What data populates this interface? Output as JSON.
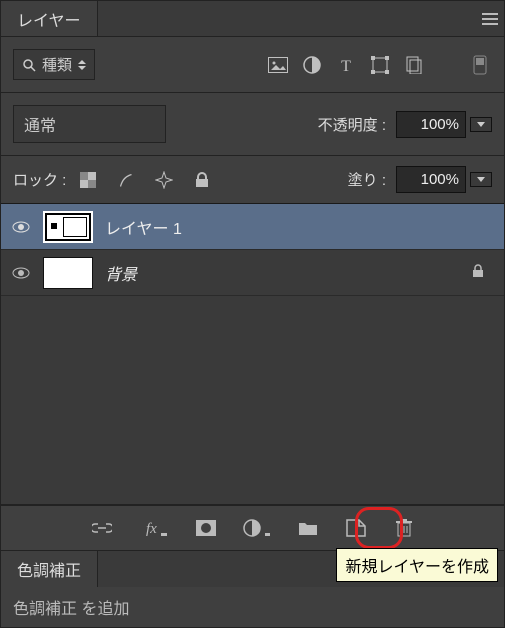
{
  "panel_title": "レイヤー",
  "filter_label": "種類",
  "blend_mode": "通常",
  "opacity_label": "不透明度 :",
  "opacity_value": "100%",
  "lock_label": "ロック :",
  "fill_label": "塗り :",
  "fill_value": "100%",
  "layers": [
    {
      "name": "レイヤー 1",
      "selected": true,
      "locked": false
    },
    {
      "name": "背景",
      "selected": false,
      "locked": true
    }
  ],
  "tooltip_text": "新規レイヤーを作成",
  "adjustments_panel_title": "色調補正",
  "adjustments_hint": "色調補正 を追加"
}
